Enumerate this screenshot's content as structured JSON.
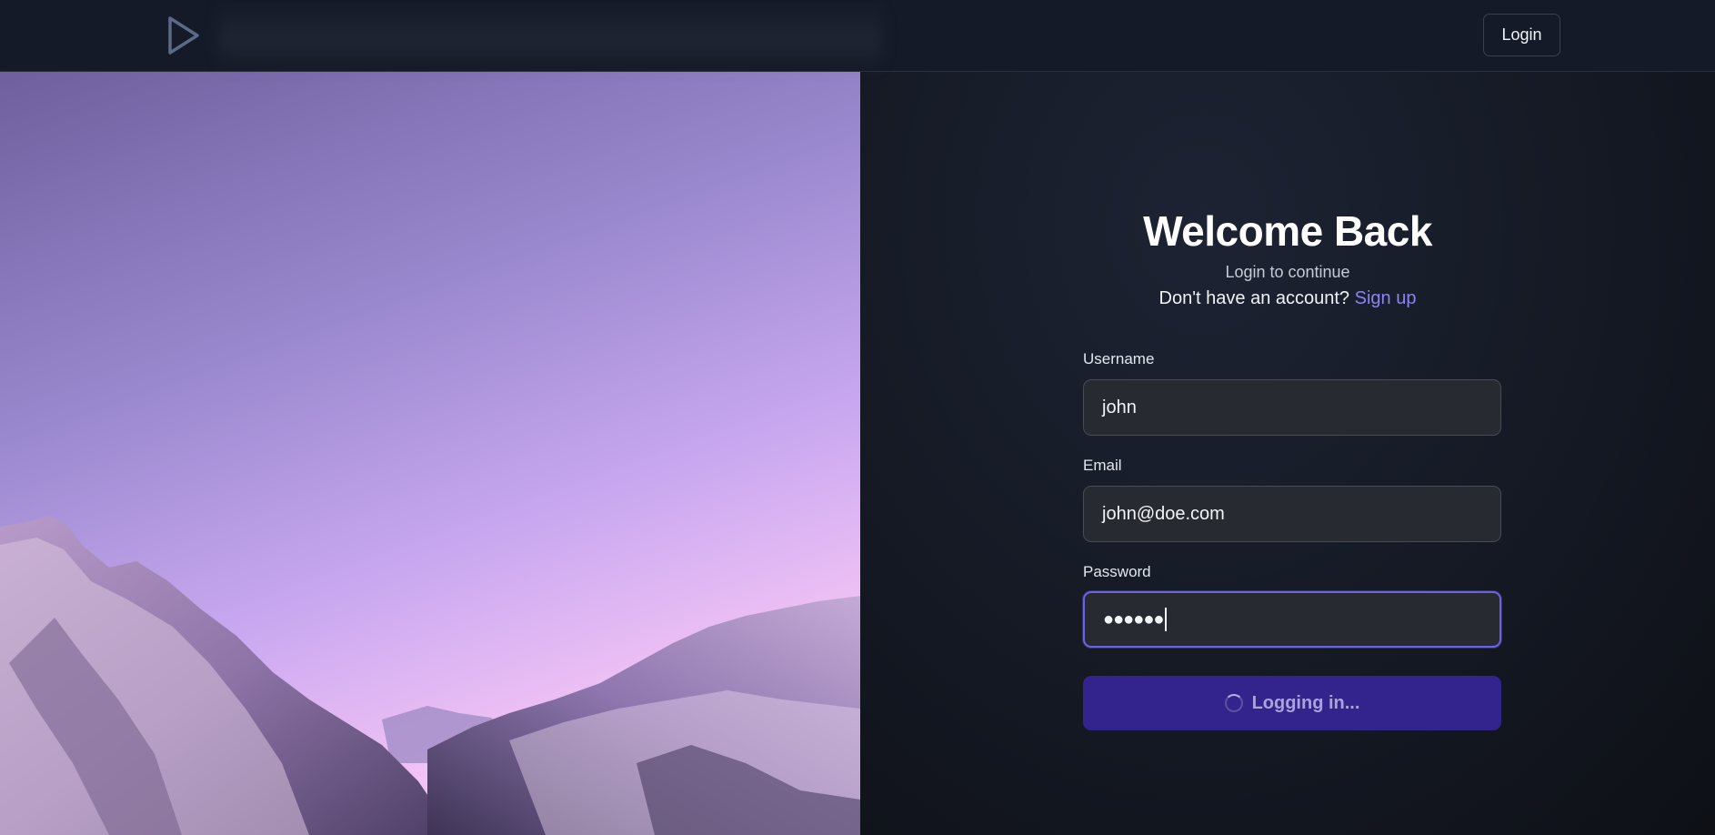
{
  "header": {
    "logo_icon": "play-triangle-icon",
    "login_button_label": "Login"
  },
  "login": {
    "title": "Welcome Back",
    "subtitle": "Login to continue",
    "signup_prompt": "Don't have an account?",
    "signup_link": "Sign up",
    "fields": {
      "username": {
        "label": "Username",
        "value": "john"
      },
      "email": {
        "label": "Email",
        "value": "john@doe.com"
      },
      "password": {
        "label": "Password",
        "value": "●●●●●●"
      }
    },
    "submit_label": "Logging in...",
    "submit_icon": "spinner-icon"
  },
  "colors": {
    "accent": "#6a63e6",
    "link": "#8b84f4",
    "submit_bg": "#33238c",
    "panel_bg": "#151a25"
  }
}
